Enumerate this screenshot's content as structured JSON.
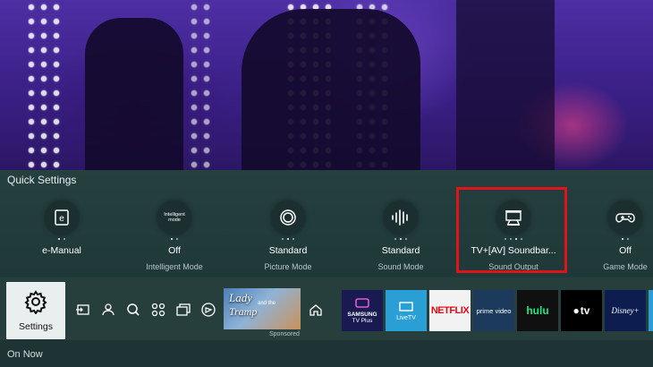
{
  "quick_settings": {
    "title": "Quick Settings",
    "items": [
      {
        "value": "e-Manual",
        "label": "",
        "icon": "e-manual-icon"
      },
      {
        "value": "Off",
        "label": "Intelligent Mode",
        "icon": "intelligent-mode-icon",
        "icon_text_1": "Intelligent",
        "icon_text_2": "mode"
      },
      {
        "value": "Standard",
        "label": "Picture Mode",
        "icon": "picture-mode-icon"
      },
      {
        "value": "Standard",
        "label": "Sound Mode",
        "icon": "sound-mode-icon"
      },
      {
        "value": "TV+[AV] Soundbar...",
        "label": "Sound Output",
        "icon": "soundbar-icon"
      },
      {
        "value": "Off",
        "label": "Game Mode",
        "icon": "gamepad-icon"
      }
    ]
  },
  "home_bar": {
    "settings_label": "Settings",
    "nav_icons": [
      "source-icon",
      "user-icon",
      "search-icon",
      "apps-icon",
      "ambient-icon",
      "media-icon",
      "home-icon"
    ],
    "promo": {
      "line1": "Lady",
      "line2": "Tramp",
      "small": "and the",
      "sponsored": "Sponsored"
    },
    "apps": [
      {
        "name": "SAMSUNG TV Plus",
        "line1": "SAMSUNG",
        "line2": "TV Plus",
        "bg": "#1a1a52"
      },
      {
        "name": "LiveTV",
        "line1": "LiveTV",
        "bg": "#2a9fd6"
      },
      {
        "name": "NETFLIX",
        "line1": "NETFLIX",
        "bg": "#f2f2f2",
        "color": "#e50914"
      },
      {
        "name": "prime video",
        "line1": "prime video",
        "bg": "#1b3a5c"
      },
      {
        "name": "hulu",
        "line1": "hulu",
        "bg": "#101010",
        "color": "#1ce783"
      },
      {
        "name": "Apple TV",
        "line1": "tv",
        "bg": "#000000"
      },
      {
        "name": "Disney+",
        "line1": "Disney+",
        "bg": "#0d1d4f"
      }
    ]
  },
  "on_now": {
    "label": "On Now"
  },
  "colors": {
    "highlight": "#e0121a",
    "panel": "#25403f"
  }
}
